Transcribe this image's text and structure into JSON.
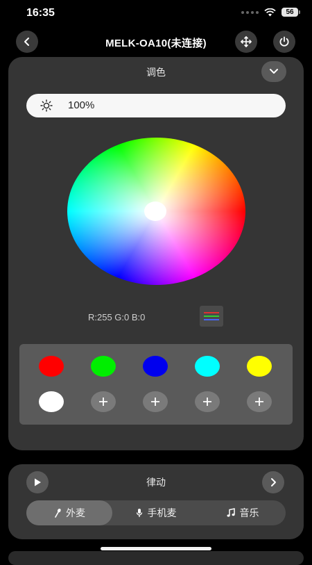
{
  "status": {
    "time": "16:35",
    "battery": "56"
  },
  "nav": {
    "title": "MELK-OA10(未连接)",
    "back_icon": "chevron-left-icon",
    "move_icon": "move-arrows-icon",
    "power_icon": "power-icon"
  },
  "color_panel": {
    "title": "调色",
    "brightness_value": "100%",
    "rgb_readout": "R:255 G:0 B:0",
    "swatches": [
      "#ff0000",
      "#00ee00",
      "#0000ee",
      "#00ffff",
      "#ffff00",
      "#ffffff"
    ]
  },
  "rhythm_panel": {
    "title": "律动",
    "modes": [
      {
        "label": "外麦",
        "icon": "microphone-wand-icon",
        "active": true
      },
      {
        "label": "手机麦",
        "icon": "microphone-icon",
        "active": false
      },
      {
        "label": "音乐",
        "icon": "music-note-icon",
        "active": false
      }
    ]
  }
}
